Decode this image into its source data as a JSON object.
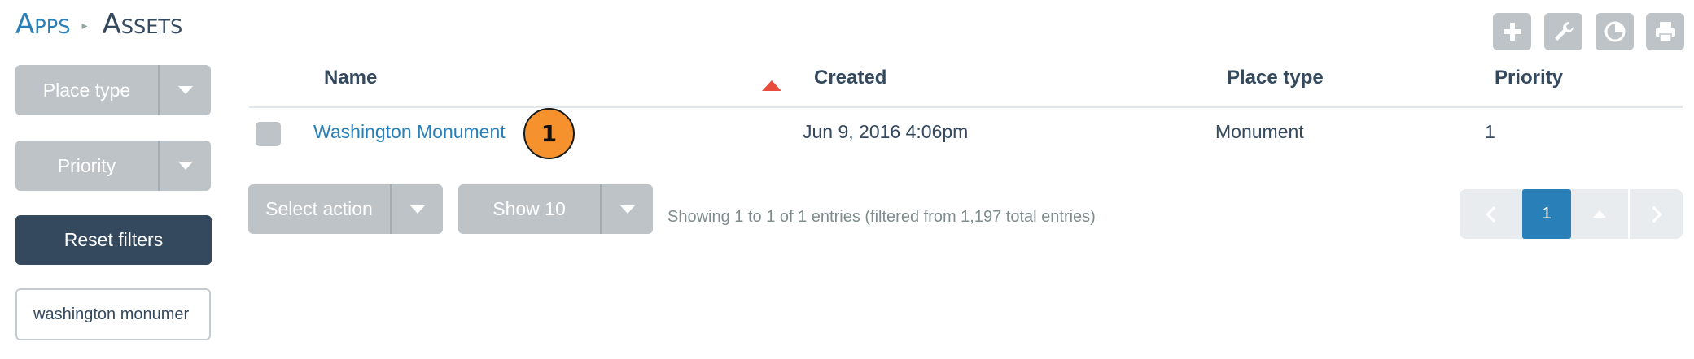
{
  "breadcrumb": {
    "root": "Apps",
    "current": "Assets"
  },
  "toolbar": {
    "icons": [
      "plus-icon",
      "wrench-icon",
      "pie-chart-icon",
      "printer-icon"
    ],
    "accent": "#bdc3c7"
  },
  "filters": {
    "place_type": "Place type",
    "priority": "Priority",
    "reset": "Reset filters",
    "search_value": "washington monumer"
  },
  "table": {
    "headers": {
      "name": "Name",
      "created": "Created",
      "place_type": "Place type",
      "priority": "Priority"
    },
    "sort": {
      "column": "created",
      "direction": "ascending",
      "indicator_color": "#e74c3c"
    },
    "rows": [
      {
        "name": "Washington Monument",
        "created": "Jun 9, 2016 4:06pm",
        "place_type": "Monument",
        "priority": "1"
      }
    ]
  },
  "annotation": {
    "label": "1",
    "color": "#f5922d"
  },
  "actions": {
    "select_action": "Select action",
    "show": "Show 10"
  },
  "summary": "Showing 1 to 1 of 1 entries (filtered from 1,197 total entries)",
  "pagination": {
    "current_page": "1"
  },
  "colors": {
    "primary": "#2980b9",
    "dark": "#34495e",
    "muted": "#bdc3c7",
    "pager_bg": "#e8ecee"
  }
}
